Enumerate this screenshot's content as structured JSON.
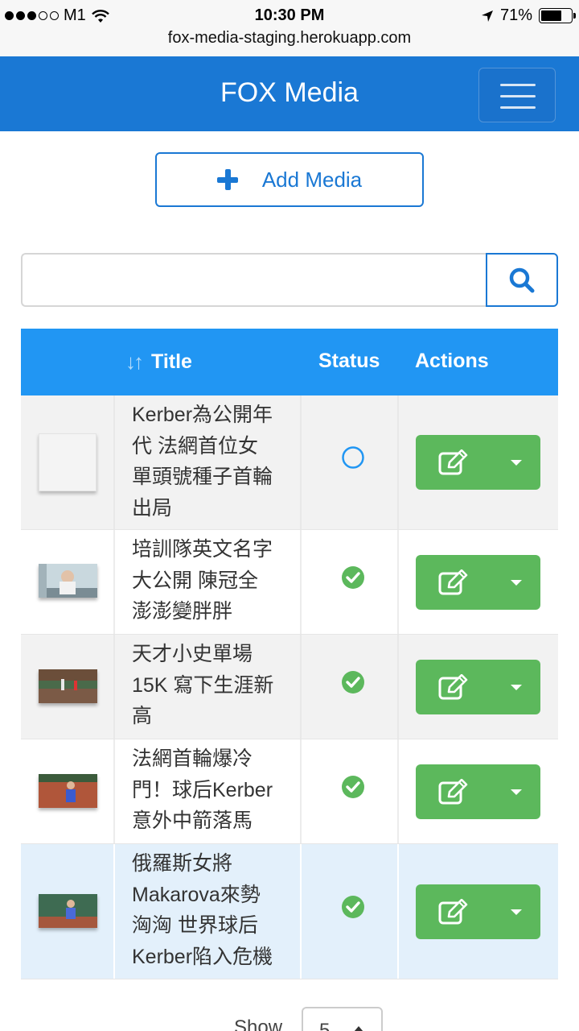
{
  "status_bar": {
    "carrier": "M1",
    "time": "10:30 PM",
    "battery": "71%",
    "url": "fox-media-staging.herokuapp.com"
  },
  "navbar": {
    "brand": "FOX Media",
    "menu_icon": "hamburger-icon"
  },
  "toolbar": {
    "add_label": "Add Media"
  },
  "search": {
    "value": "",
    "placeholder": ""
  },
  "table": {
    "headers": {
      "title": "Title",
      "status": "Status",
      "actions": "Actions"
    },
    "rows": [
      {
        "title_lines": [
          "Kerber為公開年",
          "代 法網首位女",
          "單頭號種子首輪",
          "出局"
        ],
        "status": "pending",
        "thumbnail": "blank"
      },
      {
        "title_lines": [
          "培訓隊英文名字",
          "大公開 陳冠全",
          "澎澎變胖胖"
        ],
        "status": "published",
        "thumbnail": "photo"
      },
      {
        "title_lines": [
          "天才小史單場",
          "15K 寫下生涯新",
          "高"
        ],
        "status": "published",
        "thumbnail": "photo"
      },
      {
        "title_lines": [
          "法網首輪爆冷",
          "門！球后Kerber",
          "意外中箭落馬"
        ],
        "status": "published",
        "thumbnail": "photo"
      },
      {
        "title_lines": [
          "俄羅斯女將",
          "Makarova來勢",
          "洶洶 世界球后",
          "Kerber陷入危機"
        ],
        "status": "published",
        "thumbnail": "photo"
      }
    ]
  },
  "footer": {
    "show_label": "Show",
    "page_size": "5"
  },
  "colors": {
    "navbar": "#1a78d4",
    "table_header": "#2196f3",
    "action_button": "#5cb85c",
    "status_ok": "#5cb85c",
    "status_pending": "#2196f3"
  }
}
